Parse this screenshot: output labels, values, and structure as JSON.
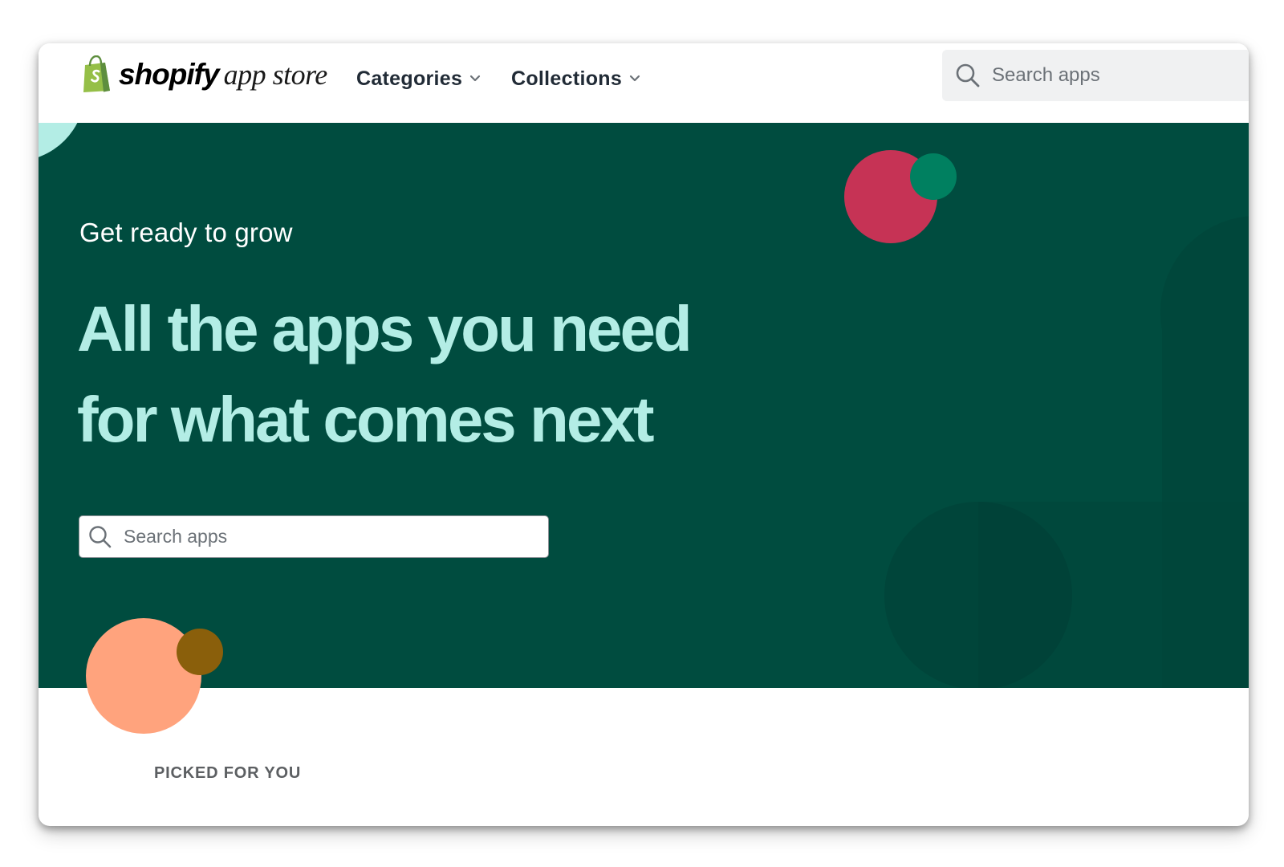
{
  "header": {
    "logo_word": "shopify",
    "logo_sub": "app store",
    "nav": [
      {
        "label": "Categories"
      },
      {
        "label": "Collections"
      }
    ],
    "search_placeholder": "Search apps"
  },
  "hero": {
    "tagline": "Get ready to grow",
    "headline_line1": "All the apps you need",
    "headline_line2": "for what comes next",
    "search_placeholder": "Search apps",
    "background_color": "#004c3f",
    "headline_color": "#b3ede5"
  },
  "section": {
    "title": "PICKED FOR YOU"
  },
  "icons": [
    "shopify-bag-icon",
    "chevron-down-icon",
    "search-icon"
  ],
  "colors": {
    "brand_green": "#95bf47",
    "hero_dark": "#004c3f",
    "accent_red": "#c63355",
    "accent_teal": "#008060",
    "accent_peach": "#ffa37d",
    "accent_brown": "#8a5f0b",
    "accent_mint": "#b3ede5"
  }
}
